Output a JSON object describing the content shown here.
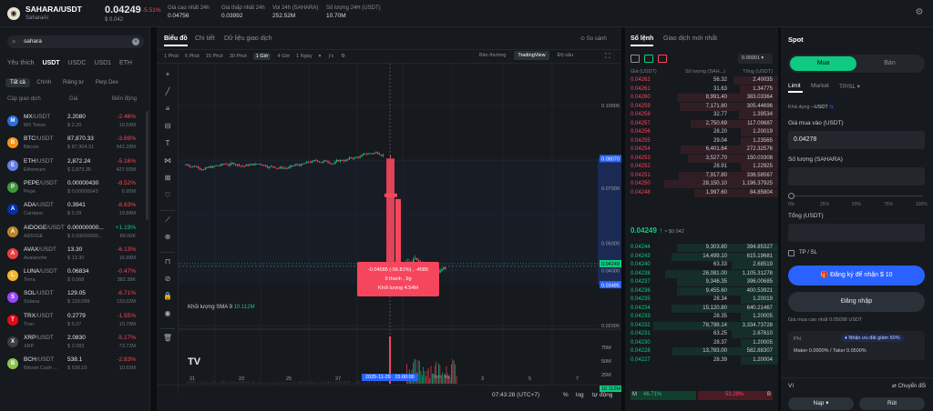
{
  "header": {
    "pair": "SAHARA/USDT",
    "project": "SaharaAI",
    "price": "0.04249",
    "change": "-5.51%",
    "usd_price": "$ 0.042",
    "stats": [
      {
        "label": "Giá cao nhất 24h",
        "value": "0.04756"
      },
      {
        "label": "Giá thấp nhất 24h",
        "value": "0.03992"
      },
      {
        "label": "Vol 24h (SAHARA)",
        "value": "252.52M"
      },
      {
        "label": "Số lượng 24H (USDT)",
        "value": "10.70M"
      }
    ]
  },
  "markets": {
    "search_value": "sahara",
    "tabs": [
      "Yêu thích",
      "USDT",
      "USDC",
      "USD1",
      "ETH"
    ],
    "filters": [
      "Tất cả",
      "Chính",
      "Riêng tư",
      "Perp Dex"
    ],
    "head": {
      "pair": "Cặp giao dịch",
      "price": "Giá",
      "change": "Biến động"
    },
    "rows": [
      {
        "base": "MX",
        "quote": "/USDT",
        "name": "MX Token",
        "price": "2.2080",
        "usd": "$ 2.20",
        "change": "-2.46%",
        "vol": "10.59M",
        "color": "#2a6fdb",
        "up": false
      },
      {
        "base": "BTC",
        "quote": "/USDT",
        "name": "Bitcoin",
        "price": "87,870.33",
        "usd": "$ 87,904.31",
        "change": "-3.69%",
        "vol": "542.28M",
        "color": "#f7931a",
        "up": false
      },
      {
        "base": "ETH",
        "quote": "/USDT",
        "name": "Ethereum",
        "price": "2,872.24",
        "usd": "$ 2,873.35",
        "change": "-5.16%",
        "vol": "427.55M",
        "color": "#627eea",
        "up": false
      },
      {
        "base": "PEPE",
        "quote": "/USDT",
        "name": "Pepe",
        "price": "0.00000430",
        "usd": "$ 0.00000043",
        "change": "-8.52%",
        "vol": "6.95M",
        "color": "#3c9a3c",
        "up": false
      },
      {
        "base": "ADA",
        "quote": "/USDT",
        "name": "Cardano",
        "price": "0.3941",
        "usd": "$ 0.39",
        "change": "-8.63%",
        "vol": "19.88M",
        "color": "#0033ad",
        "up": false
      },
      {
        "base": "AIDOGE",
        "quote": "/USDT",
        "name": "AIDOGE",
        "price": "0.00000000...",
        "usd": "$ 0.00000000...",
        "change": "+1.19%",
        "vol": "89.00K",
        "color": "#b8862b",
        "up": true
      },
      {
        "base": "AVAX",
        "quote": "/USDT",
        "name": "Avalanche",
        "price": "13.30",
        "usd": "$ 13.30",
        "change": "-6.13%",
        "vol": "16.98M",
        "color": "#e84142",
        "up": false
      },
      {
        "base": "LUNA",
        "quote": "/USDT",
        "name": "Terra",
        "price": "0.06834",
        "usd": "$ 0.068",
        "change": "-0.47%",
        "vol": "382.38K",
        "color": "#f4b731",
        "up": false
      },
      {
        "base": "SOL",
        "quote": "/USDT",
        "name": "Solana",
        "price": "129.05",
        "usd": "$ 129.099",
        "change": "-6.71%",
        "vol": "133.02M",
        "color": "#9945ff",
        "up": false
      },
      {
        "base": "TRX",
        "quote": "/USDT",
        "name": "Tron",
        "price": "0.2779",
        "usd": "$ 0.27",
        "change": "-1.55%",
        "vol": "10.78M",
        "color": "#e50915",
        "up": false
      },
      {
        "base": "XRP",
        "quote": "/USDT",
        "name": "XRP",
        "price": "2.0830",
        "usd": "$ 2.083",
        "change": "-5.17%",
        "vol": "73.72M",
        "color": "#3b3f45",
        "up": false
      },
      {
        "base": "BCH",
        "quote": "/USDT",
        "name": "Bitcoin Cash ...",
        "price": "538.1",
        "usd": "$ 538.10",
        "change": "-2.83%",
        "vol": "10.65M",
        "color": "#8dc351",
        "up": false
      }
    ]
  },
  "chart": {
    "tabs": [
      "Biểu đồ",
      "Chi tiết",
      "Dữ liệu giao dịch"
    ],
    "compare": "So sánh",
    "intervals": [
      "1 Phút",
      "5 Phút",
      "15 Phút",
      "30 Phút",
      "1 Giờ",
      "4 Giờ",
      "1 Ngày"
    ],
    "active_interval": "1 Giờ",
    "views": [
      "Bản thường",
      "TradingView",
      "Độ sâu"
    ],
    "price_ticks": [
      "0.10000",
      "0.08070",
      "0.07000",
      "0.05000",
      "0.04249",
      "0.04000",
      "0.03485",
      "0.02000"
    ],
    "volume_label": "Khối lượng SMA 9",
    "volume_value": "10.112M",
    "volume_ticks": [
      "75M",
      "50M",
      "25M",
      "10.112M"
    ],
    "date_ticks": [
      "21",
      "23",
      "25",
      "27",
      "",
      "",
      "3",
      "5",
      "7"
    ],
    "cursor_date": "2025-11-29",
    "cursor_time": "15:00:00",
    "cursor_extra": "thời hai",
    "tooltip": {
      "line1": "-0.04585 (-56.81%) , -4585",
      "line2": "9 thanh , 9g",
      "line3": "Khối lượng 4.54M"
    },
    "time": "07:43:28 (UTC+7)",
    "pct": "%",
    "log": "log",
    "auto": "tự động"
  },
  "orderbook": {
    "tabs": [
      "Sổ lệnh",
      "Giao dịch mới nhất"
    ],
    "precision": "0.00001",
    "head": {
      "price": "Giá (USDT)",
      "qty": "Số lượng (SAH...)",
      "total": "Tổng (USDT)"
    },
    "asks": [
      [
        "0.04262",
        "56.32",
        "2.40035"
      ],
      [
        "0.04261",
        "31.63",
        "1.34775"
      ],
      [
        "0.04260",
        "8,991.40",
        "383.03364"
      ],
      [
        "0.04259",
        "7,171.80",
        "305.44696"
      ],
      [
        "0.04258",
        "32.77",
        "1.39534"
      ],
      [
        "0.04257",
        "2,750.69",
        "117.09687"
      ],
      [
        "0.04256",
        "28.20",
        "1.20019"
      ],
      [
        "0.04255",
        "29.04",
        "1.23565"
      ],
      [
        "0.04254",
        "6,401.64",
        "272.32576"
      ],
      [
        "0.04253",
        "3,527.70",
        "150.03308"
      ],
      [
        "0.04252",
        "28.91",
        "1.22925"
      ],
      [
        "0.04251",
        "7,917.80",
        "336.58567"
      ],
      [
        "0.04250",
        "28,150.10",
        "1,196.37925"
      ],
      [
        "0.04248",
        "1,997.60",
        "84.85804"
      ]
    ],
    "last_price": "0.04249",
    "last_usd": "≈ $0.042",
    "bids": [
      [
        "0.04244",
        "9,303.80",
        "394.85327"
      ],
      [
        "0.04243",
        "14,499.10",
        "615.19681"
      ],
      [
        "0.04240",
        "63.33",
        "2.68519"
      ],
      [
        "0.04238",
        "26,081.00",
        "1,105.31278"
      ],
      [
        "0.04237",
        "9,346.35",
        "396.00685"
      ],
      [
        "0.04236",
        "9,455.60",
        "400.53921"
      ],
      [
        "0.04235",
        "28.34",
        "1.20019"
      ],
      [
        "0.04234",
        "15,120.80",
        "640.21467"
      ],
      [
        "0.04233",
        "28.35",
        "1.20005"
      ],
      [
        "0.04232",
        "78,798.14",
        "3,334.73728"
      ],
      [
        "0.04231",
        "63.25",
        "2.67610"
      ],
      [
        "0.04230",
        "28.37",
        "1.20005"
      ],
      [
        "0.04228",
        "13,783.00",
        "582.88307"
      ],
      [
        "0.04227",
        "28.39",
        "1.20004"
      ]
    ],
    "buy_label": "M",
    "buy_pct": "46.71%",
    "sell_pct": "53.29%",
    "sell_label": "B",
    "buy_ratio": 0.4671
  },
  "spot": {
    "title": "Spot",
    "buy": "Mua",
    "sell": "Bán",
    "order_types": [
      "Limit",
      "Market",
      "TP/SL ▾"
    ],
    "available_label": "Khả dụng",
    "available_value": "--USDT",
    "price_label": "Giá mua vào (USDT)",
    "price_value": "0.04278",
    "qty_label": "Số lượng (SAHARA)",
    "qty_value": "",
    "slider_ticks": [
      "0%",
      "25%",
      "50%",
      "75%",
      "100%"
    ],
    "total_label": "Tổng (USDT)",
    "tpsl": "TP / SL",
    "register": "Đăng ký để nhận $ 10",
    "login": "Đăng nhập",
    "max_buy": "Giá mua cao nhất 0.05098 USDT",
    "fee_label": "Phí",
    "fee_badge": "Nhận ưu đãi giảm 50%",
    "fee_text": "Maker 0.0000% / Taker 0.0500%",
    "wallet_label": "Ví",
    "transfer": "Chuyển đổi",
    "deposit": "Nạp ▾",
    "withdraw": "Rút"
  },
  "colors": {
    "up": "#0ecb81",
    "down": "#f6465d",
    "accent_buy": "#0ecb81",
    "accent_blue": "#2962ff"
  }
}
